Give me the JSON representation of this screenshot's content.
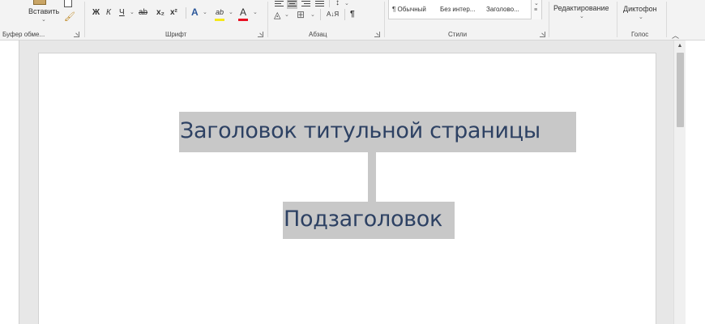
{
  "ribbon": {
    "clipboard": {
      "paste_label": "Вставить",
      "group_label": "Буфер обме..."
    },
    "font": {
      "bold": "Ж",
      "italic": "К",
      "underline": "Ч",
      "strike": "ab",
      "subscript": "x₂",
      "superscript": "x²",
      "effects": "A",
      "highlight": "ab",
      "font_color": "A",
      "group_label": "Шрифт",
      "highlight_color": "#f5e81a",
      "font_color_value": "#e81123"
    },
    "paragraph": {
      "line_spacing": "↕",
      "sort": "А↓Я",
      "pilcrow": "¶",
      "group_label": "Абзац"
    },
    "styles": {
      "items": [
        "¶ Обычный",
        "Без интер...",
        "Заголово..."
      ],
      "group_label": "Стили"
    },
    "editing": {
      "label": "Редактирование"
    },
    "voice": {
      "dictate_label": "Диктофон",
      "group_label": "Голос"
    }
  },
  "document": {
    "title": "Заголовок титульной страницы",
    "subtitle": "Подзаголовок",
    "text_color": "#2d4163",
    "highlight_color": "#c8c8c8"
  }
}
